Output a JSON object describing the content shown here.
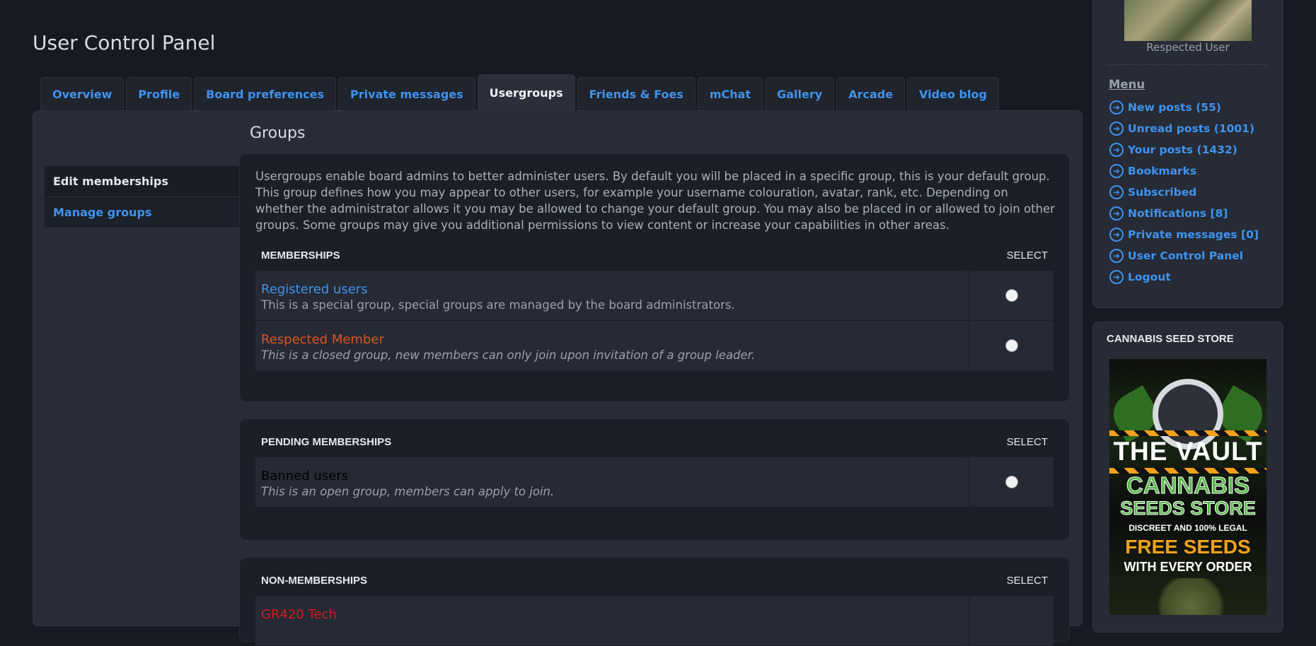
{
  "page": {
    "title": "User Control Panel"
  },
  "tabs": [
    {
      "label": "Overview",
      "active": false
    },
    {
      "label": "Profile",
      "active": false
    },
    {
      "label": "Board preferences",
      "active": false
    },
    {
      "label": "Private messages",
      "active": false
    },
    {
      "label": "Usergroups",
      "active": true
    },
    {
      "label": "Friends & Foes",
      "active": false
    },
    {
      "label": "mChat",
      "active": false
    },
    {
      "label": "Gallery",
      "active": false
    },
    {
      "label": "Arcade",
      "active": false
    },
    {
      "label": "Video blog",
      "active": false
    }
  ],
  "side_nav": [
    {
      "label": "Edit memberships",
      "active": true
    },
    {
      "label": "Manage groups",
      "active": false
    }
  ],
  "groups_section": {
    "title": "Groups",
    "intro": "Usergroups enable board admins to better administer users. By default you will be placed in a specific group, this is your default group. This group defines how you may appear to other users, for example your username colouration, avatar, rank, etc. Depending on whether the administrator allows it you may be allowed to change your default group. You may also be placed in or allowed to join other groups. Some groups may give you additional permissions to view content or increase your capabilities in other areas."
  },
  "memberships": {
    "header": "MEMBERSHIPS",
    "select_header": "SELECT",
    "rows": [
      {
        "name": "Registered users",
        "color": "#3f93ee",
        "description": "This is a special group, special groups are managed by the board administrators.",
        "italic": false
      },
      {
        "name": "Respected Member",
        "color": "#d9541e",
        "description": "This is a closed group, new members can only join upon invitation of a group leader.",
        "italic": true
      }
    ]
  },
  "pending_memberships": {
    "header": "PENDING MEMBERSHIPS",
    "select_header": "SELECT",
    "rows": [
      {
        "name": "Banned users",
        "color": "#000000",
        "description": "This is an open group, members can apply to join.",
        "italic": true
      }
    ]
  },
  "non_memberships": {
    "header": "NON-MEMBERSHIPS",
    "select_header": "SELECT",
    "rows": [
      {
        "name": "GR420 Tech",
        "color": "#d01c1c"
      }
    ]
  },
  "profile_card": {
    "rank": "Respected User",
    "menu_heading": "Menu",
    "menu_items": [
      {
        "label": "New posts (55)",
        "icon": "arrow-circle-right-icon"
      },
      {
        "label": "Unread posts (1001)",
        "icon": "arrow-circle-right-icon"
      },
      {
        "label": "Your posts (1432)",
        "icon": "arrow-circle-right-icon"
      },
      {
        "label": "Bookmarks",
        "icon": "arrow-circle-right-icon"
      },
      {
        "label": "Subscribed",
        "icon": "arrow-circle-right-icon"
      },
      {
        "label": "Notifications [8]",
        "icon": "arrow-circle-right-icon"
      },
      {
        "label": "Private messages [0]",
        "icon": "arrow-circle-right-icon"
      },
      {
        "label": "User Control Panel",
        "icon": "arrow-circle-right-icon"
      },
      {
        "label": "Logout",
        "icon": "arrow-circle-right-icon"
      }
    ]
  },
  "ad": {
    "title": "CANNABIS SEED STORE",
    "banner_lines": [
      "THE VAULT",
      "CANNABIS",
      "SEEDS STORE",
      "DISCREET AND 100% LEGAL",
      "FREE SEEDS",
      "WITH EVERY ORDER"
    ]
  },
  "colors": {
    "link": "#3f93ee",
    "background": "#161a22",
    "panel": "#272c37"
  }
}
